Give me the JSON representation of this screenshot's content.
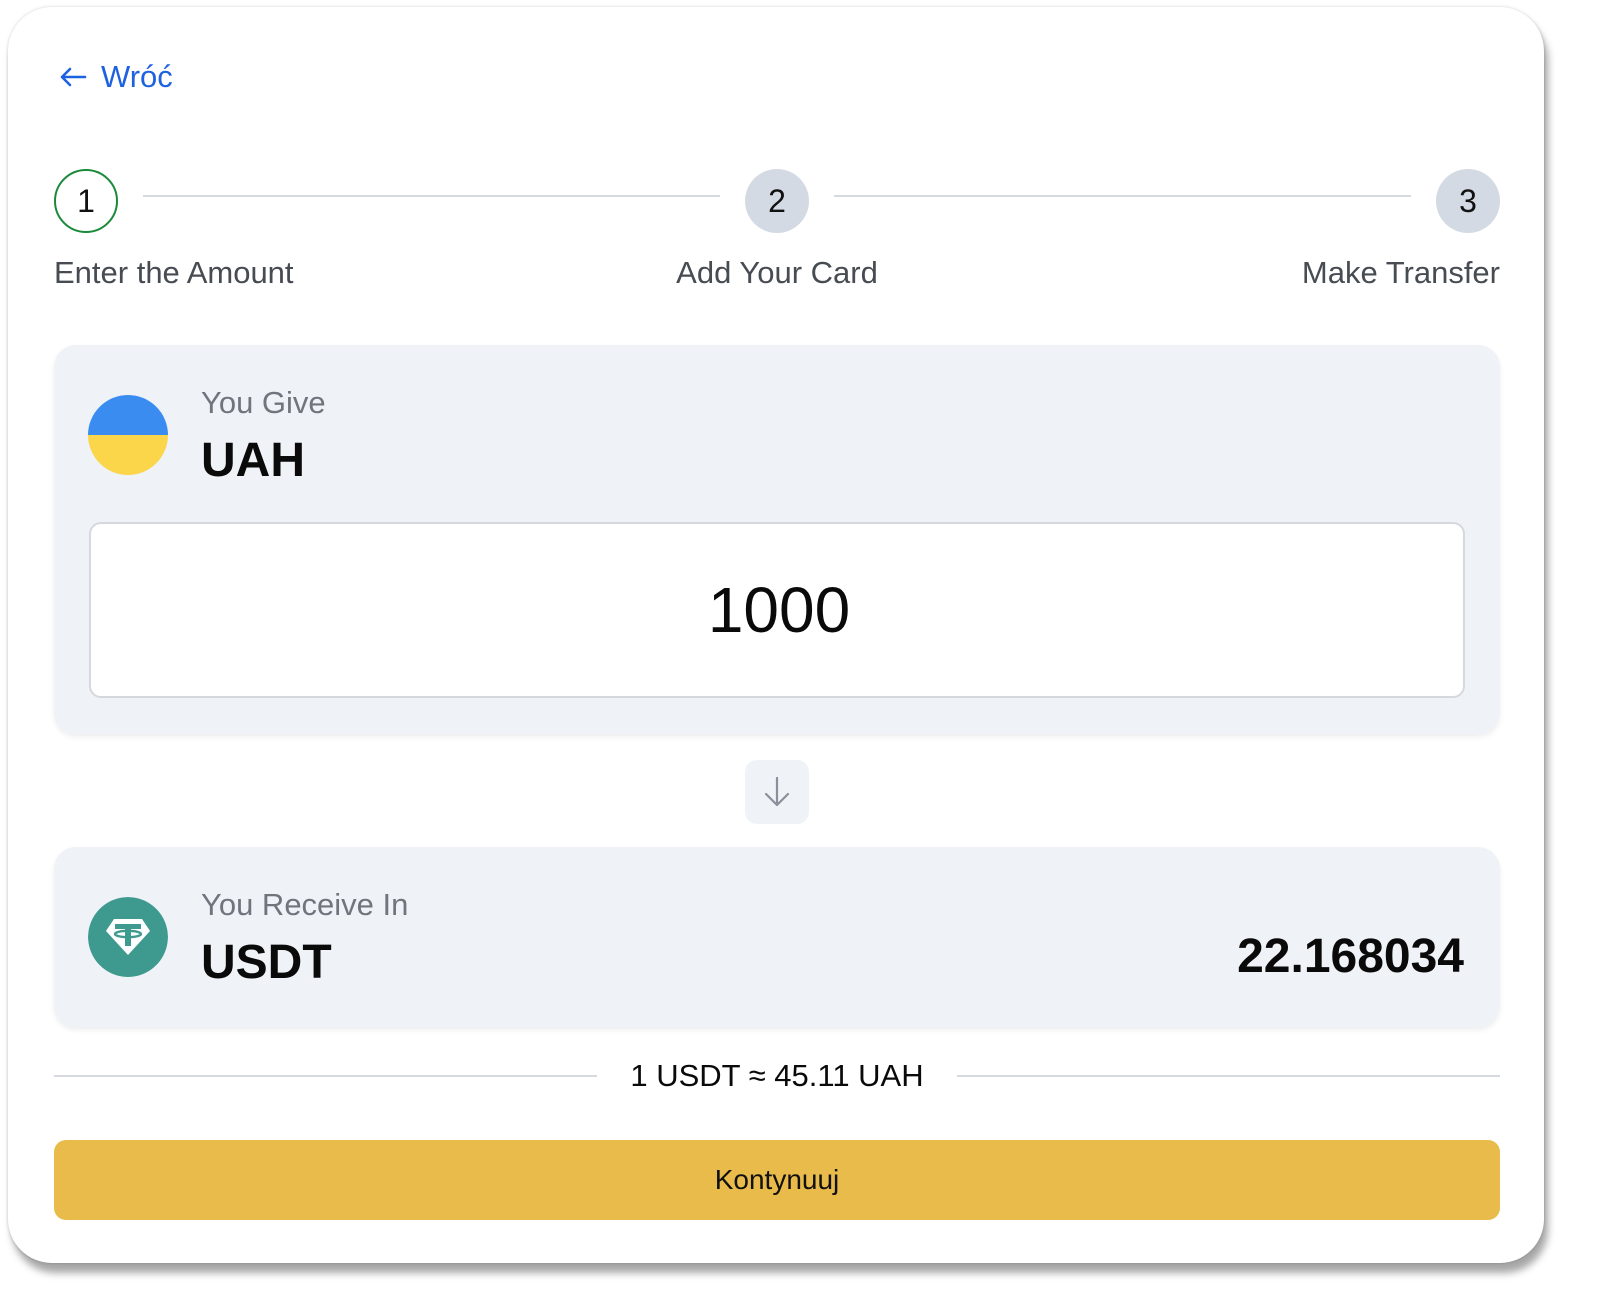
{
  "nav": {
    "back_label": "Wróć"
  },
  "stepper": {
    "steps": [
      {
        "number": "1",
        "label": "Enter the Amount",
        "state": "active"
      },
      {
        "number": "2",
        "label": "Add Your Card",
        "state": "pending"
      },
      {
        "number": "3",
        "label": "Make Transfer",
        "state": "pending"
      }
    ]
  },
  "give": {
    "caption": "You Give",
    "currency": "UAH",
    "amount": "1000",
    "icon": "ukraine-flag-icon"
  },
  "receive": {
    "caption": "You Receive In",
    "currency": "USDT",
    "amount": "22.168034",
    "icon": "tether-icon"
  },
  "rate": {
    "text": "1 USDT ≈ 45.11 UAH"
  },
  "actions": {
    "continue_label": "Kontynuuj"
  },
  "colors": {
    "link": "#1f62e0",
    "active_step_border": "#1a8a3a",
    "pending_step": "#d4dae3",
    "card_bg": "#eff2f7",
    "primary_button": "#e8bb4a",
    "flag_blue": "#3a8cf0",
    "flag_yellow": "#fbd64a",
    "tether_green": "#3e9a8f"
  }
}
